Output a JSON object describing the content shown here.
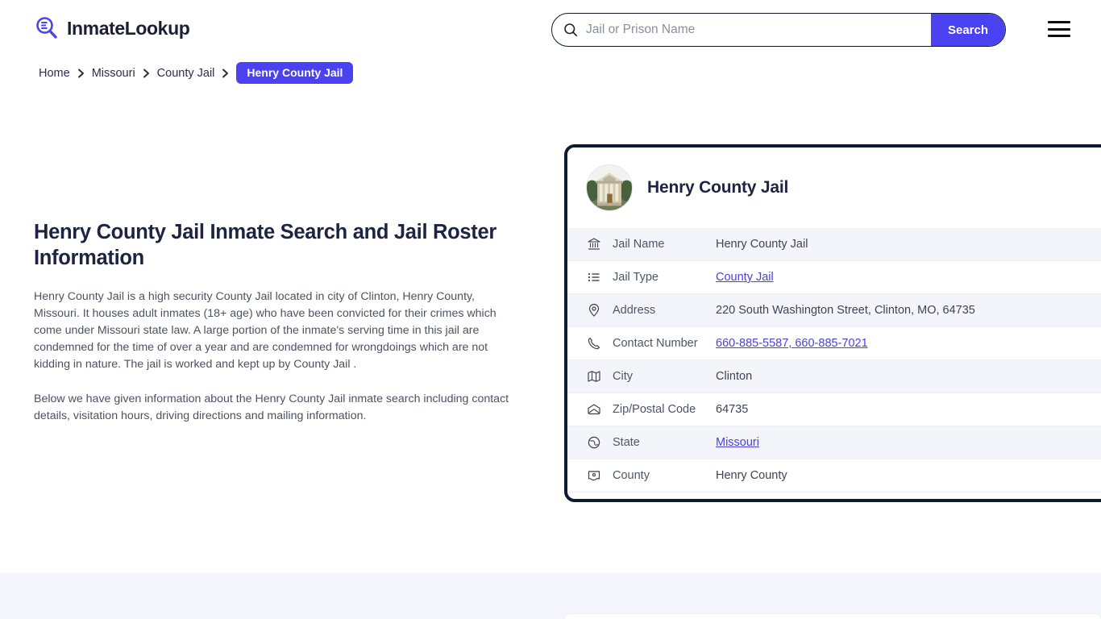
{
  "header": {
    "logo_text": "InmateLookup",
    "logo_icon": "magnifier-list-icon",
    "search": {
      "placeholder": "Jail or Prison Name",
      "value": "",
      "icon": "search-icon",
      "button_label": "Search",
      "button_color": "#4a42f0"
    },
    "menu_icon": "hamburger-menu-icon"
  },
  "breadcrumb": {
    "items": [
      {
        "label": "Home",
        "current": false
      },
      {
        "label": "Missouri",
        "current": false
      },
      {
        "label": "County Jail",
        "current": false
      },
      {
        "label": "Henry County Jail",
        "current": true
      }
    ],
    "separator_icon": "chevron-right-icon",
    "current_pill_color": "#4a42f0"
  },
  "main": {
    "title": "Henry County Jail Inmate Search and Jail Roster Information",
    "paragraphs": [
      "Henry County Jail is a high security County Jail located in city of Clinton, Henry County, Missouri. It houses adult inmates (18+ age) who have been convicted for their crimes which come under Missouri state law. A large portion of the inmate's serving time in this jail are condemned for the time of over a year and are condemned for wrongdoings which are not kidding in nature. The jail is worked and kept up by County Jail .",
      "Below we have given information about the Henry County Jail inmate search including contact details, visitation hours, driving directions and mailing information."
    ]
  },
  "info_card": {
    "title": "Henry County Jail",
    "thumbnail_icon": "courthouse-photo",
    "border_color": "#101a2e",
    "rows": [
      {
        "icon": "bank-icon",
        "label": "Jail Name",
        "value": "Henry County Jail",
        "link": false
      },
      {
        "icon": "list-icon",
        "label": "Jail Type",
        "value": "County Jail",
        "link": true
      },
      {
        "icon": "map-pin-icon",
        "label": "Address",
        "value": "220 South Washington Street, Clinton, MO, 64735",
        "link": false
      },
      {
        "icon": "phone-icon",
        "label": "Contact Number",
        "value": "660-885-5587, 660-885-7021",
        "link": true
      },
      {
        "icon": "map-icon",
        "label": "City",
        "value": "Clinton",
        "link": false
      },
      {
        "icon": "envelope-icon",
        "label": "Zip/Postal Code",
        "value": "64735",
        "link": false
      },
      {
        "icon": "globe-icon",
        "label": "State",
        "value": "Missouri",
        "link": true
      },
      {
        "icon": "county-icon",
        "label": "County",
        "value": "Henry County",
        "link": false
      }
    ]
  }
}
